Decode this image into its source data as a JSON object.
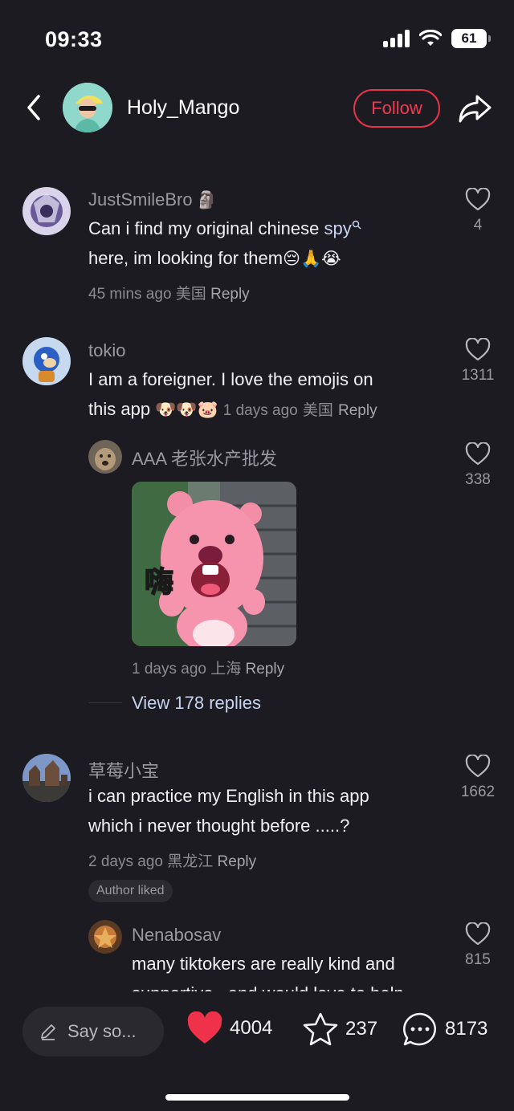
{
  "status_bar": {
    "time": "09:33",
    "battery": "61"
  },
  "header": {
    "username": "Holy_Mango",
    "follow_label": "Follow"
  },
  "comments": [
    {
      "username": "JustSmileBro",
      "username_emoji": "🗿",
      "text_line1": "Can i find my original chinese ",
      "link_text": "spy",
      "text_line2": "here, im looking for them",
      "text_line2_emoji": "😔🙏😭",
      "time": "45 mins ago",
      "location": "美国",
      "reply_label": "Reply",
      "likes": "4"
    },
    {
      "username": "tokio",
      "text_line1": "I am a foreigner. I love the emojis on",
      "text_line2": "this app",
      "text_line2_emoji": "🐶🐶🐷",
      "time": "1 days ago",
      "location": "美国",
      "reply_label": "Reply",
      "likes": "1311",
      "reply": {
        "username": "AAA 老张水产批发",
        "sticker_text": "嗨",
        "time": "1 days ago",
        "location": "上海",
        "reply_label": "Reply",
        "likes": "338"
      },
      "view_replies": "View 178 replies"
    },
    {
      "username": "草莓小宝",
      "text_line1": "i can practice my English in this app",
      "text_line2": "which i never thought before .....?",
      "time": "2 days ago",
      "location": "黑龙江",
      "reply_label": "Reply",
      "likes": "1662",
      "badge": "Author liked",
      "reply": {
        "username": "Nenabosav",
        "text_line1": "many tiktokers are really kind and",
        "text_line2": "supportive , and would love to help",
        "likes": "815"
      }
    }
  ],
  "bottom_bar": {
    "input_placeholder": "Say so...",
    "likes": "4004",
    "favorites": "237",
    "comments": "8173"
  },
  "colors": {
    "background": "#1c1b22",
    "accent_red": "#ef3b52",
    "heart_red": "#f0314a"
  }
}
